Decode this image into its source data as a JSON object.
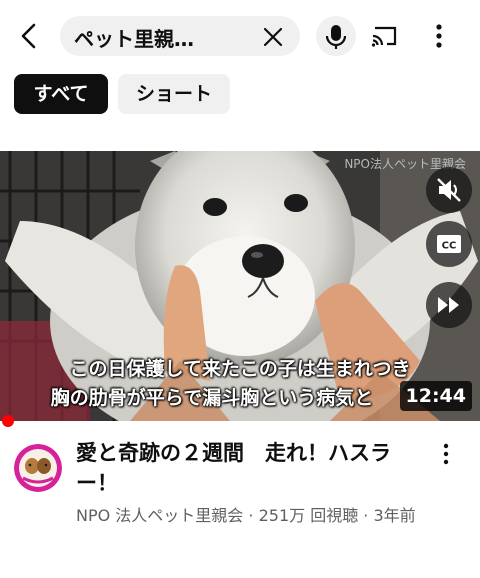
{
  "search": {
    "query": "ペット里親…"
  },
  "chips": [
    {
      "label": "すべて",
      "selected": true
    },
    {
      "label": "ショート",
      "selected": false
    }
  ],
  "video": {
    "watermark": "NPO法人ペット里親会",
    "captions": [
      "この日保護して来たこの子は生まれつき",
      "胸の肋骨が平らで漏斗胸という病気と"
    ],
    "duration": "12:44",
    "controls": [
      "mute-icon",
      "closed-captions-icon",
      "fast-forward-icon"
    ],
    "progress": 0.0
  },
  "result": {
    "title": "愛と奇跡の２週間　走れ！ハスラー！",
    "channel": "NPO 法人ペット里親会",
    "views": "251万 回視聴",
    "age": "3年前",
    "separator": " · "
  },
  "colors": {
    "accent": "#ff0000",
    "chip_selected": "#0f0f0f",
    "chip": "#f0f0f0",
    "secondary_text": "#606060"
  }
}
